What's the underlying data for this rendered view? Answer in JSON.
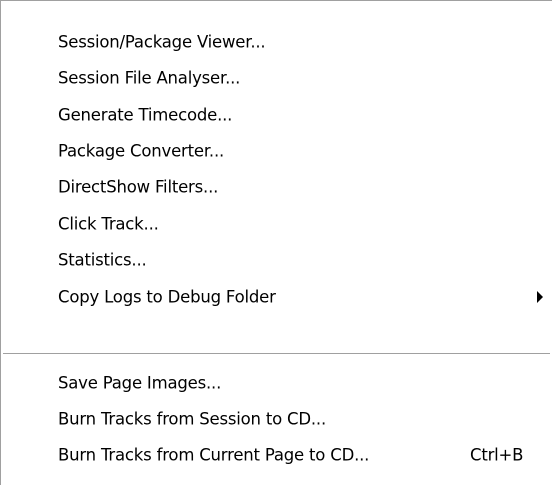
{
  "menu": {
    "items": [
      {
        "label": "Session/Package Viewer..."
      },
      {
        "label": "Session File Analyser..."
      },
      {
        "label": "Generate Timecode..."
      },
      {
        "label": "Package Converter..."
      },
      {
        "label": "DirectShow Filters..."
      },
      {
        "label": "Click Track..."
      },
      {
        "label": "Statistics..."
      },
      {
        "label": "Copy Logs to Debug Folder",
        "submenu_icon": "submenu-arrow-icon"
      },
      {
        "label": "Save Page Images..."
      },
      {
        "label": "Burn Tracks from Session to CD..."
      },
      {
        "label": "Burn Tracks from Current Page to CD...",
        "shortcut": "Ctrl+B"
      }
    ]
  },
  "colors": {
    "background": "#ffffff",
    "text": "#000000",
    "separator": "#a0a0a0",
    "highlight": "#316ac5"
  }
}
